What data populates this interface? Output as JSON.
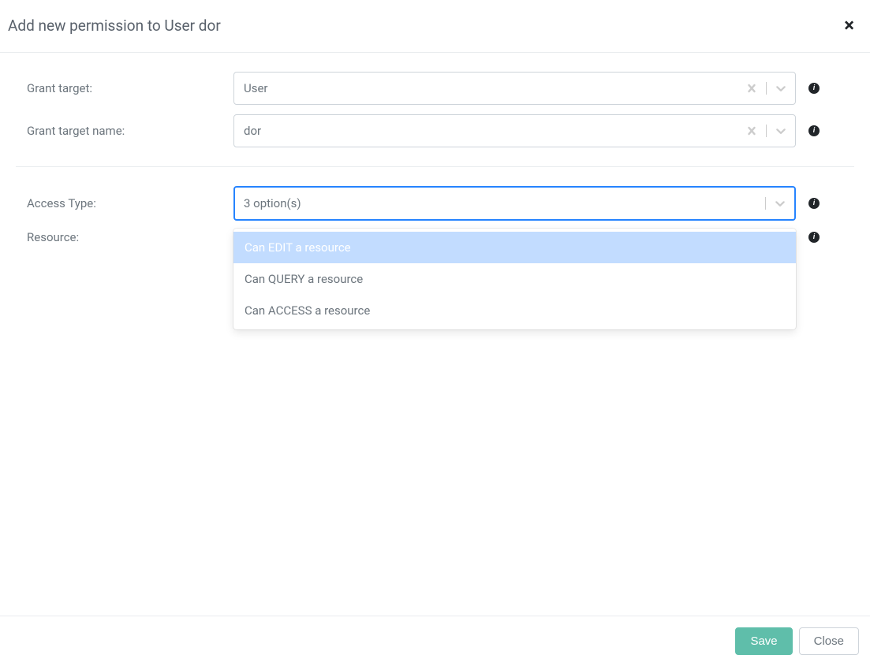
{
  "header": {
    "title": "Add new permission to User dor"
  },
  "form": {
    "grant_target": {
      "label": "Grant target:",
      "value": "User"
    },
    "grant_target_name": {
      "label": "Grant target name:",
      "value": "dor"
    },
    "access_type": {
      "label": "Access Type:",
      "placeholder": "3 option(s)",
      "options": [
        "Can EDIT a resource",
        "Can QUERY a resource",
        "Can ACCESS a resource"
      ]
    },
    "resource": {
      "label": "Resource:"
    }
  },
  "footer": {
    "save_label": "Save",
    "close_label": "Close"
  }
}
